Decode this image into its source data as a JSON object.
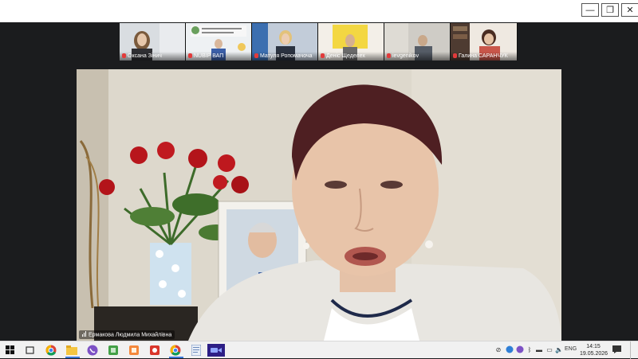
{
  "window": {
    "minimize_glyph": "—",
    "restore_glyph": "❐",
    "close_glyph": "✕"
  },
  "participants": [
    {
      "name": "Оксана Зінич",
      "bg": "#cfd4da"
    },
    {
      "name": "NUBIP ВАП",
      "bg": "#eaeef1"
    },
    {
      "name": "Матуля Ропомачоча",
      "bg": "#bac6d6"
    },
    {
      "name": "Деніс Щеделех",
      "bg": "#f2eee7"
    },
    {
      "name": "ievgenikov",
      "bg": "#c9c6c1"
    },
    {
      "name": "Галина САРАНЧУК",
      "bg": "#6f5b50"
    }
  ],
  "speaker": {
    "name": "Ермакова Людмила Михайлівна"
  },
  "taskbar": {
    "apps": [
      "windows-start",
      "task-view",
      "chrome",
      "file-explorer",
      "viber",
      "files",
      "app-orange",
      "app-red",
      "chrome-alt",
      "notepad",
      "zoom"
    ],
    "tray_icons": [
      "network-off",
      "globe",
      "viber-tray",
      "bluetooth",
      "vpn",
      "monitor",
      "battery",
      "volume"
    ],
    "language": "ENG",
    "time": "14:15",
    "date": "19.05.2026"
  }
}
